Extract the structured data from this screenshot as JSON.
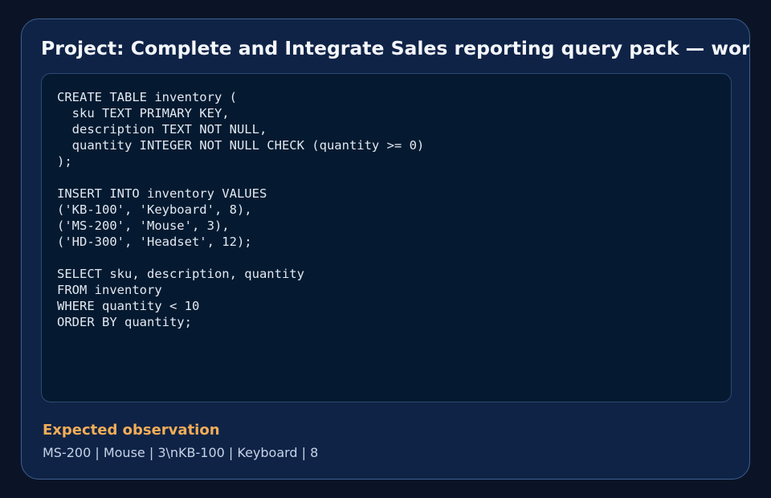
{
  "project": {
    "title": "Project: Complete and Integrate Sales reporting query pack — work"
  },
  "code": {
    "lines": [
      "CREATE TABLE inventory (",
      "  sku TEXT PRIMARY KEY,",
      "  description TEXT NOT NULL,",
      "  quantity INTEGER NOT NULL CHECK (quantity >= 0)",
      ");",
      "",
      "INSERT INTO inventory VALUES",
      "('KB-100', 'Keyboard', 8),",
      "('MS-200', 'Mouse', 3),",
      "('HD-300', 'Headset', 12);",
      "",
      "SELECT sku, description, quantity",
      "FROM inventory",
      "WHERE quantity < 10",
      "ORDER BY quantity;"
    ]
  },
  "observation": {
    "label": "Expected observation",
    "value": "MS-200 | Mouse | 3\\nKB-100 | Keyboard | 8"
  }
}
